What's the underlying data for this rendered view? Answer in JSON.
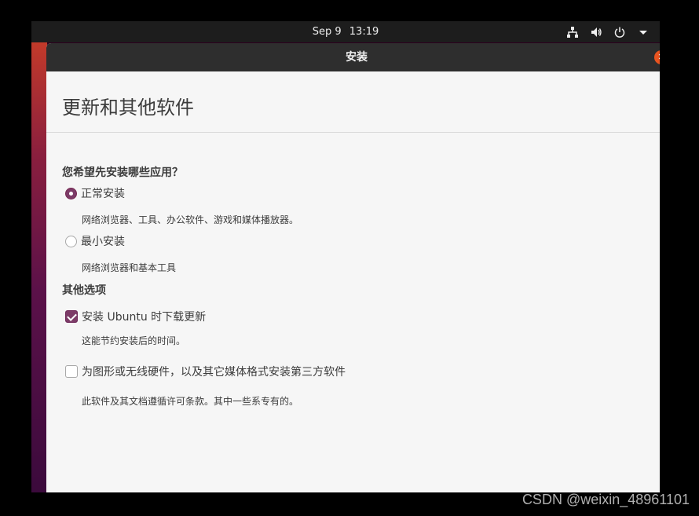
{
  "topbar": {
    "date": "Sep 9",
    "time": "13:19",
    "icons": [
      "network-icon",
      "volume-icon",
      "power-icon",
      "menu-arrow-icon"
    ]
  },
  "window": {
    "title": "安装",
    "close_icon": "close-icon"
  },
  "page": {
    "title": "更新和其他软件"
  },
  "install_type": {
    "heading": "您希望先安装哪些应用？",
    "options": [
      {
        "label": "正常安装",
        "description": "网络浏览器、工具、办公软件、游戏和媒体播放器。",
        "selected": true
      },
      {
        "label": "最小安装",
        "description": "网络浏览器和基本工具",
        "selected": false
      }
    ]
  },
  "other_options": {
    "heading": "其他选项",
    "items": [
      {
        "label": "安装 Ubuntu 时下载更新",
        "description": "这能节约安装后的时间。",
        "checked": true
      },
      {
        "label": "为图形或无线硬件，以及其它媒体格式安装第三方软件",
        "description": "此软件及其文档遵循许可条款。其中一些系专有的。",
        "checked": false
      }
    ]
  },
  "watermark": "CSDN @weixin_48961101",
  "colors": {
    "accent": "#7c3b67",
    "close": "#e95420",
    "topbar": "#1d1d1d",
    "titlebar": "#2e2e2e"
  }
}
